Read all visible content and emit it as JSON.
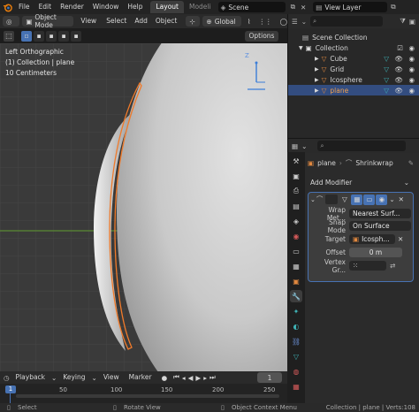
{
  "topbar": {
    "menus": [
      "File",
      "Edit",
      "Render",
      "Window",
      "Help"
    ],
    "workspaces": [
      {
        "label": "Layout",
        "active": true
      },
      {
        "label": "Modeli",
        "active": false
      }
    ],
    "scene": "Scene",
    "view_layer": "View Layer"
  },
  "viewport_header": {
    "mode": "Object Mode",
    "menus": [
      "View",
      "Select",
      "Add",
      "Object"
    ],
    "orientation": "Global",
    "options": "Options"
  },
  "viewport": {
    "view_name": "Left Orthographic",
    "collection_info": "(1) Collection | plane",
    "scale": "10 Centimeters",
    "gizmo_axis_label": "Z"
  },
  "outliner": {
    "scene_collection": "Scene Collection",
    "collection": "Collection",
    "items": [
      {
        "label": "Cube",
        "selected": false,
        "color": "#e0883f"
      },
      {
        "label": "Grid",
        "selected": false,
        "color": "#e0883f"
      },
      {
        "label": "Icosphere",
        "selected": false,
        "color": "#e0883f"
      },
      {
        "label": "plane",
        "selected": true,
        "color": "#e0883f"
      }
    ]
  },
  "properties": {
    "object_name": "plane",
    "modifier_tab": "Shrinkwrap",
    "add_modifier": "Add Modifier",
    "wrap_method_label": "Wrap Met...",
    "wrap_method_value": "Nearest Surf...",
    "snap_mode_label": "Snap Mode",
    "snap_mode_value": "On Surface",
    "target_label": "Target",
    "target_value": "Icosph...",
    "offset_label": "Offset",
    "offset_value": "0 m",
    "vertex_group_label": "Vertex Gr..."
  },
  "timeline": {
    "menus": [
      "Playback",
      "Keying",
      "View",
      "Marker"
    ],
    "current_frame": "1",
    "ruler_ticks": [
      "1",
      "50",
      "100",
      "150",
      "200",
      "250"
    ]
  },
  "statusbar": {
    "select": "Select",
    "rotate": "Rotate View",
    "context": "Object Context Menu",
    "info": "Collection | plane | Verts:108"
  },
  "colors": {
    "accent": "#4772b3",
    "selection_outline": "#f07a2a",
    "object_orange": "#e0883f",
    "modifier_teal": "#3fb1b4"
  }
}
